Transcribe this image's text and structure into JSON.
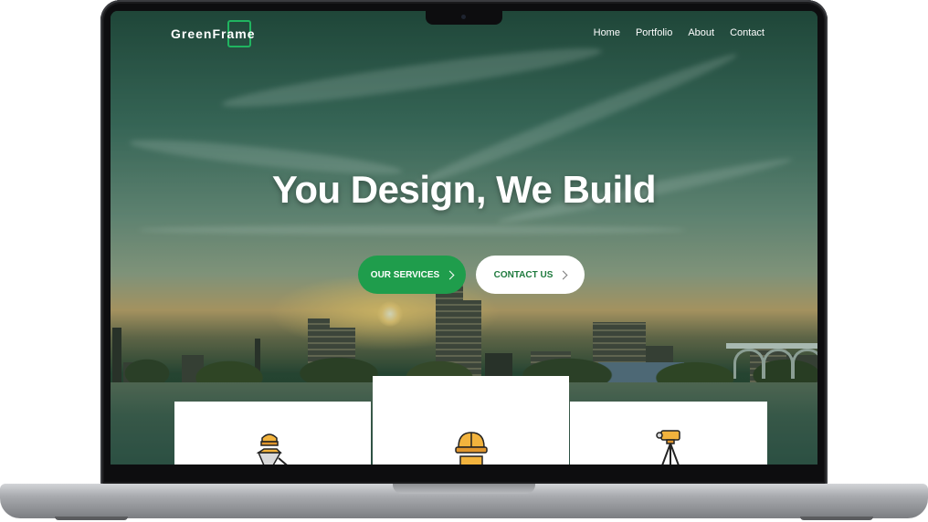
{
  "brand": {
    "name": "GreenFrame",
    "accent": "#1f9d4c"
  },
  "nav": {
    "items": [
      "Home",
      "Portfolio",
      "About",
      "Contact"
    ]
  },
  "hero": {
    "title": "You Design, We Build",
    "primary_button": "OUR SERVICES",
    "secondary_button": "CONTACT US"
  },
  "services": {
    "icons": [
      "worker-wheelbarrow-icon",
      "hard-hat-icon",
      "surveyor-tripod-icon"
    ]
  }
}
